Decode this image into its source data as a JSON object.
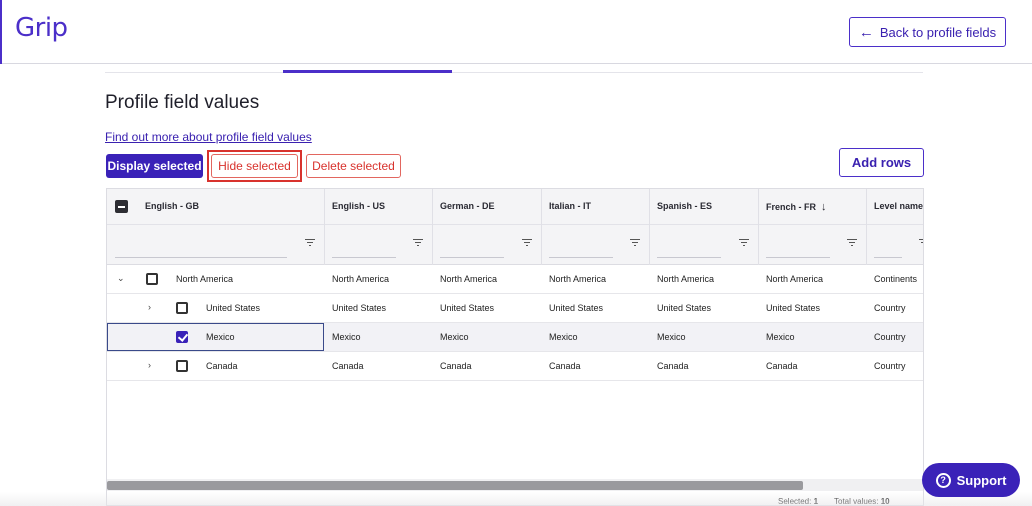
{
  "app": {
    "logo_text": "Grip",
    "brand_color": "#4b2fc9",
    "danger_color": "#d8322d"
  },
  "header": {
    "back_label": "Back to profile fields",
    "back_icon": "arrow-left-icon"
  },
  "page": {
    "title": "Profile field values",
    "help_link": "Find out more about profile field values"
  },
  "toolbar": {
    "display_label": "Display selected",
    "hide_label": "Hide selected",
    "delete_label": "Delete selected",
    "add_label": "Add rows"
  },
  "table": {
    "columns": [
      "English - GB",
      "English - US",
      "German - DE",
      "Italian - IT",
      "Spanish - ES",
      "French - FR",
      "Level name"
    ],
    "sorted_column": "French - FR",
    "sort_icon": "arrow-down-icon",
    "rows": [
      {
        "values": [
          "North America",
          "North America",
          "North America",
          "North America",
          "North America",
          "North America",
          "Continents"
        ],
        "expanded": true,
        "checked": false,
        "level": 0
      },
      {
        "values": [
          "United States",
          "United States",
          "United States",
          "United States",
          "United States",
          "United States",
          "Country"
        ],
        "expanded": false,
        "checked": false,
        "level": 1
      },
      {
        "values": [
          "Mexico",
          "Mexico",
          "Mexico",
          "Mexico",
          "Mexico",
          "Mexico",
          "Country"
        ],
        "expanded": null,
        "checked": true,
        "level": 1
      },
      {
        "values": [
          "Canada",
          "Canada",
          "Canada",
          "Canada",
          "Canada",
          "Canada",
          "Country"
        ],
        "expanded": false,
        "checked": false,
        "level": 1
      }
    ]
  },
  "footer": {
    "selected_label": "Selected:",
    "selected_count": "1",
    "total_label": "Total values:",
    "total_count": "10"
  },
  "support": {
    "label": "Support",
    "icon": "question-circle-icon"
  }
}
